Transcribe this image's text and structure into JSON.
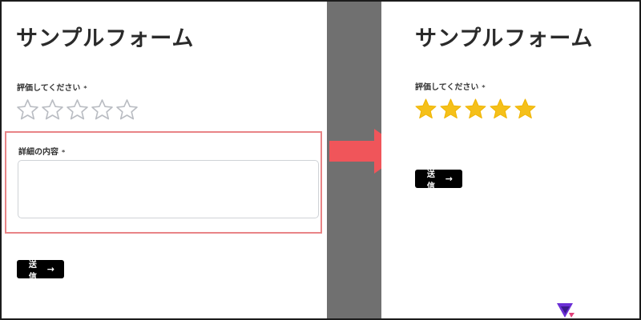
{
  "before": {
    "form_title": "サンプルフォーム",
    "rating_label": "評価してください",
    "required_mark": "*",
    "rating_value": 0,
    "rating_max": 5,
    "detail_label": "詳細の内容",
    "detail_value": "",
    "submit_label": "送信"
  },
  "after": {
    "form_title": "サンプルフォーム",
    "rating_label": "評価してください",
    "required_mark": "*",
    "rating_value": 5,
    "rating_max": 5,
    "submit_label": "送信"
  },
  "icons": {
    "star": "star-icon",
    "arrow": "arrow-right-icon",
    "transition": "transition-arrow-icon",
    "logo": "brand-logo-icon"
  },
  "colors": {
    "star_filled": "#f5c01a",
    "star_empty_outline": "#b9bcc2",
    "highlight_border": "#e88486",
    "transition_arrow": "#f0555a",
    "divider": "#707070",
    "button_bg": "#000000"
  }
}
